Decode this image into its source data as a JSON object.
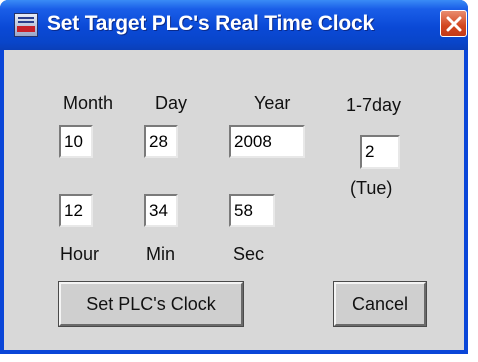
{
  "window": {
    "title": "Set Target PLC's Real Time Clock"
  },
  "date": {
    "month_label": "Month",
    "day_label": "Day",
    "year_label": "Year",
    "weekday_label": "1-7day",
    "month": "10",
    "day": "28",
    "year": "2008",
    "weekday": "2",
    "weekday_name": "(Tue)"
  },
  "time": {
    "hour_label": "Hour",
    "min_label": "Min",
    "sec_label": "Sec",
    "hour": "12",
    "min": "34",
    "sec": "58"
  },
  "buttons": {
    "set_clock": "Set PLC's Clock",
    "cancel": "Cancel"
  },
  "colors": {
    "titlebar": "#0a49d6",
    "close_button": "#d2461f",
    "dialog_background": "#d8d8d8"
  }
}
